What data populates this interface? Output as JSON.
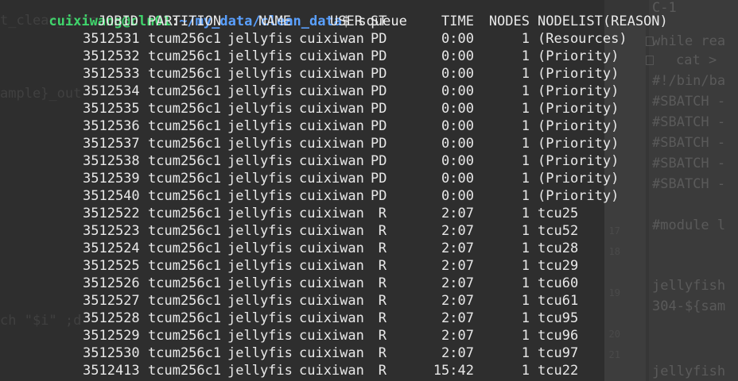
{
  "prompt": {
    "user_host": "cuixiwang@cln01",
    "separator": ":",
    "path": "~/my_data/clean_data",
    "symbol": "$",
    "command": "squeue"
  },
  "columns": [
    "JOBID",
    "PARTITION",
    "NAME",
    "USER",
    "ST",
    "TIME",
    "NODES",
    "NODELIST(REASON)"
  ],
  "jobs": [
    {
      "jobid": "3512531",
      "partition": "tcum256c1",
      "name": "jellyfis",
      "user": "cuixiwan",
      "st": "PD",
      "time": "0:00",
      "nodes": "1",
      "nodelist": "(Resources)"
    },
    {
      "jobid": "3512532",
      "partition": "tcum256c1",
      "name": "jellyfis",
      "user": "cuixiwan",
      "st": "PD",
      "time": "0:00",
      "nodes": "1",
      "nodelist": "(Priority)"
    },
    {
      "jobid": "3512533",
      "partition": "tcum256c1",
      "name": "jellyfis",
      "user": "cuixiwan",
      "st": "PD",
      "time": "0:00",
      "nodes": "1",
      "nodelist": "(Priority)"
    },
    {
      "jobid": "3512534",
      "partition": "tcum256c1",
      "name": "jellyfis",
      "user": "cuixiwan",
      "st": "PD",
      "time": "0:00",
      "nodes": "1",
      "nodelist": "(Priority)"
    },
    {
      "jobid": "3512535",
      "partition": "tcum256c1",
      "name": "jellyfis",
      "user": "cuixiwan",
      "st": "PD",
      "time": "0:00",
      "nodes": "1",
      "nodelist": "(Priority)"
    },
    {
      "jobid": "3512536",
      "partition": "tcum256c1",
      "name": "jellyfis",
      "user": "cuixiwan",
      "st": "PD",
      "time": "0:00",
      "nodes": "1",
      "nodelist": "(Priority)"
    },
    {
      "jobid": "3512537",
      "partition": "tcum256c1",
      "name": "jellyfis",
      "user": "cuixiwan",
      "st": "PD",
      "time": "0:00",
      "nodes": "1",
      "nodelist": "(Priority)"
    },
    {
      "jobid": "3512538",
      "partition": "tcum256c1",
      "name": "jellyfis",
      "user": "cuixiwan",
      "st": "PD",
      "time": "0:00",
      "nodes": "1",
      "nodelist": "(Priority)"
    },
    {
      "jobid": "3512539",
      "partition": "tcum256c1",
      "name": "jellyfis",
      "user": "cuixiwan",
      "st": "PD",
      "time": "0:00",
      "nodes": "1",
      "nodelist": "(Priority)"
    },
    {
      "jobid": "3512540",
      "partition": "tcum256c1",
      "name": "jellyfis",
      "user": "cuixiwan",
      "st": "PD",
      "time": "0:00",
      "nodes": "1",
      "nodelist": "(Priority)"
    },
    {
      "jobid": "3512522",
      "partition": "tcum256c1",
      "name": "jellyfis",
      "user": "cuixiwan",
      "st": "R",
      "time": "2:07",
      "nodes": "1",
      "nodelist": "tcu25"
    },
    {
      "jobid": "3512523",
      "partition": "tcum256c1",
      "name": "jellyfis",
      "user": "cuixiwan",
      "st": "R",
      "time": "2:07",
      "nodes": "1",
      "nodelist": "tcu52"
    },
    {
      "jobid": "3512524",
      "partition": "tcum256c1",
      "name": "jellyfis",
      "user": "cuixiwan",
      "st": "R",
      "time": "2:07",
      "nodes": "1",
      "nodelist": "tcu28"
    },
    {
      "jobid": "3512525",
      "partition": "tcum256c1",
      "name": "jellyfis",
      "user": "cuixiwan",
      "st": "R",
      "time": "2:07",
      "nodes": "1",
      "nodelist": "tcu29"
    },
    {
      "jobid": "3512526",
      "partition": "tcum256c1",
      "name": "jellyfis",
      "user": "cuixiwan",
      "st": "R",
      "time": "2:07",
      "nodes": "1",
      "nodelist": "tcu60"
    },
    {
      "jobid": "3512527",
      "partition": "tcum256c1",
      "name": "jellyfis",
      "user": "cuixiwan",
      "st": "R",
      "time": "2:07",
      "nodes": "1",
      "nodelist": "tcu61"
    },
    {
      "jobid": "3512528",
      "partition": "tcum256c1",
      "name": "jellyfis",
      "user": "cuixiwan",
      "st": "R",
      "time": "2:07",
      "nodes": "1",
      "nodelist": "tcu95"
    },
    {
      "jobid": "3512529",
      "partition": "tcum256c1",
      "name": "jellyfis",
      "user": "cuixiwan",
      "st": "R",
      "time": "2:07",
      "nodes": "1",
      "nodelist": "tcu96"
    },
    {
      "jobid": "3512530",
      "partition": "tcum256c1",
      "name": "jellyfis",
      "user": "cuixiwan",
      "st": "R",
      "time": "2:07",
      "nodes": "1",
      "nodelist": "tcu97"
    },
    {
      "jobid": "3512413",
      "partition": "tcum256c1",
      "name": "jellyfis",
      "user": "cuixiwan",
      "st": "R",
      "time": "15:42",
      "nodes": "1",
      "nodelist": "tcu22"
    }
  ],
  "background_left_fragments": [
    "t_clean_2.fo",
    "ample}_out",
    "ch \"$i\" ;d"
  ],
  "background_right_fragments": [
    "C-1",
    "while rea",
    "cat >",
    "#!/bin/ba",
    "#SBATCH -",
    "#SBATCH -",
    "#SBATCH -",
    "#SBATCH -",
    "#SBATCH -",
    "#module l",
    "jellyfish",
    "304-${sam",
    "jellyfish"
  ],
  "background_line_numbers": [
    "17",
    "18",
    "19",
    "20",
    "21"
  ],
  "colors": {
    "background": "#2e2e2e",
    "text": "#e8e8e8",
    "prompt_user": "#3fd46b",
    "prompt_path": "#5aa0ff"
  }
}
